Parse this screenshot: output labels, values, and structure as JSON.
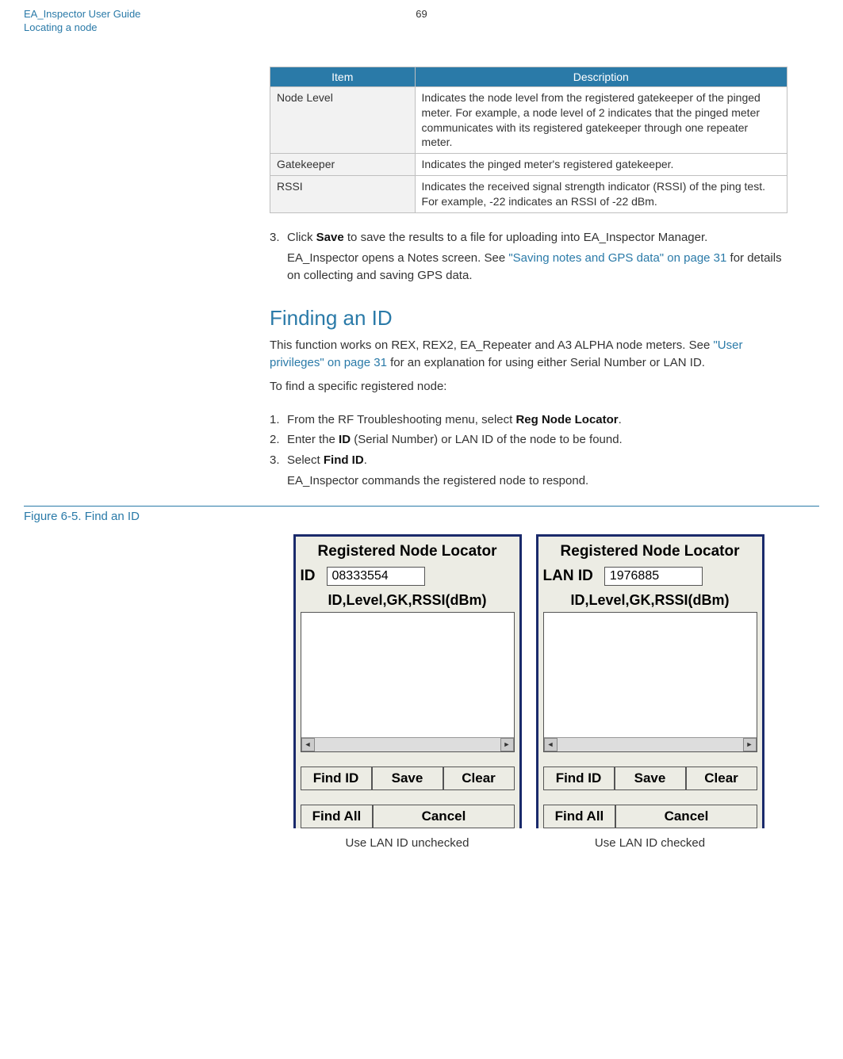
{
  "header": {
    "title": "EA_Inspector User Guide",
    "subtitle": "Locating a node",
    "page_number": "69"
  },
  "table": {
    "head_item": "Item",
    "head_desc": "Description",
    "rows": [
      {
        "item": "Node Level",
        "desc": "Indicates the node level from the registered gatekeeper of the pinged meter. For example, a node level of 2 indicates that the pinged meter communicates with its registered gatekeeper through one repeater meter."
      },
      {
        "item": "Gatekeeper",
        "desc": "Indicates the pinged meter's registered gatekeeper."
      },
      {
        "item": "RSSI",
        "desc": "Indicates the received signal strength indicator (RSSI) of the ping test. For example, -22 indicates an RSSI of -22 dBm."
      }
    ]
  },
  "step3": {
    "num": "3.",
    "text_before": "Click ",
    "bold": "Save",
    "text_after": " to save the results to a file for uploading into EA_Inspector Manager.",
    "sub_before": "EA_Inspector opens a Notes screen. See ",
    "sub_link": "\"Saving notes and GPS data\" on page 31",
    "sub_after": " for details on collecting and saving GPS data."
  },
  "section": {
    "heading": "Finding an ID",
    "intro_before": "This function works on REX, REX2, EA_Repeater and A3 ALPHA node meters. See ",
    "intro_link": "\"User privileges\" on page 31",
    "intro_after": " for an explanation for using either Serial Number or LAN ID.",
    "lead": "To find a specific registered node:"
  },
  "steps": {
    "s1": {
      "num": "1.",
      "before": "From the RF Troubleshooting menu, select ",
      "bold": "Reg Node Locator",
      "after": "."
    },
    "s2": {
      "num": "2.",
      "before": "Enter the ",
      "bold": "ID",
      "after": " (Serial Number) or LAN ID of the node to be found."
    },
    "s3": {
      "num": "3.",
      "before": "Select ",
      "bold": "Find ID",
      "after": ".",
      "sub": "EA_Inspector commands the registered node to respond."
    }
  },
  "figure": {
    "label": "Figure 6-5. Find an ID"
  },
  "panel": {
    "title": "Registered Node Locator",
    "columns": "ID,Level,GK,RSSI(dBm)",
    "find_id": "Find ID",
    "save": "Save",
    "clear": "Clear",
    "find_all": "Find All",
    "cancel": "Cancel"
  },
  "left": {
    "label": "ID",
    "value": "08333554",
    "caption": "Use LAN ID unchecked"
  },
  "right": {
    "label": "LAN ID",
    "value": "1976885",
    "caption": "Use LAN ID checked"
  }
}
